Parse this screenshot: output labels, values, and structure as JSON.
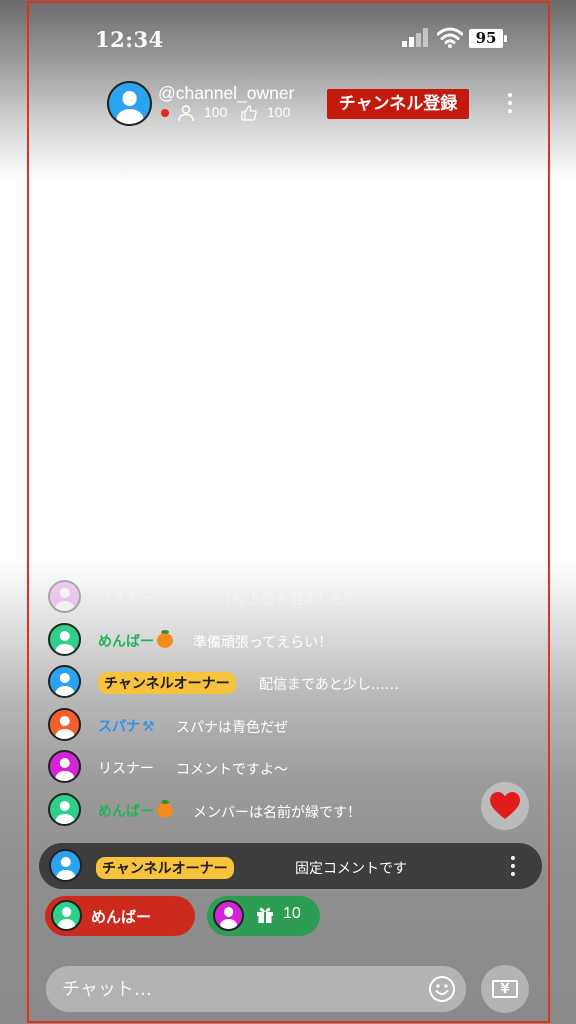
{
  "status_bar": {
    "time": "12:34",
    "battery": "95"
  },
  "header": {
    "channel_name": "@channel_owner",
    "viewers": "100",
    "likes": "100",
    "subscribe_label": "チャンネル登録"
  },
  "chat": {
    "messages": [
      {
        "name": "リスナー",
        "text": "1位上位を狙え！も5…",
        "avatar_color": "#e284e9"
      },
      {
        "name": "めんばー",
        "text": "準備頑張ってえらい！",
        "avatar_color": "#2ed18a"
      },
      {
        "name": "チャンネルオーナー",
        "text": "配信まであと少し……",
        "avatar_color": "#2aa3f0"
      },
      {
        "name": "スパナ",
        "text": "スパナは青色だぜ",
        "avatar_color": "#f2612d"
      },
      {
        "name": "リスナー",
        "text": "コメントですよ〜",
        "avatar_color": "#d325d8"
      },
      {
        "name": "めんばー",
        "text": "メンバーは名前が緑です！",
        "avatar_color": "#2ed18a"
      }
    ],
    "pinned": {
      "name": "チャンネルオーナー",
      "text": "固定コメントです"
    }
  },
  "bottom": {
    "member_pill_label": "めんばー",
    "gift_count": "10",
    "chat_placeholder": "チャット…"
  },
  "icons": [
    "signal-icon",
    "wifi-icon",
    "battery-icon",
    "user-icon",
    "thumbs-up-icon",
    "kebab-menu-icon",
    "heart-icon",
    "gift-icon",
    "smiley-icon",
    "yen-icon",
    "persimmon-icon",
    "spanner-icon"
  ],
  "colors": {
    "accent_red": "#c41a0e",
    "owner_badge": "#f6c33b",
    "member_green": "#21b35a",
    "spanner_blue": "#2a94f0"
  }
}
